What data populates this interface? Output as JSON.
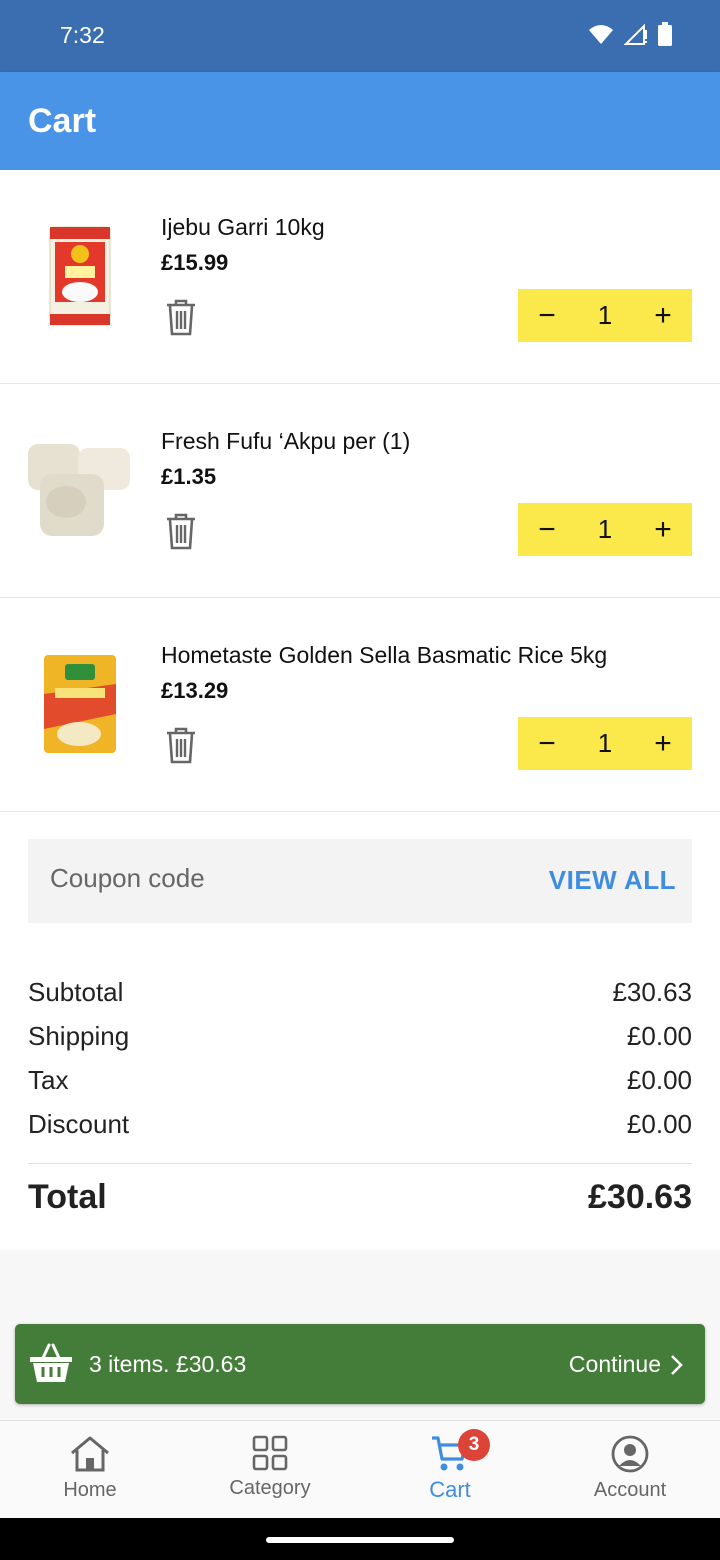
{
  "status_bar": {
    "time": "7:32"
  },
  "app_bar": {
    "title": "Cart"
  },
  "cart": {
    "items": [
      {
        "name": "Ijebu Garri 10kg",
        "price": "£15.99",
        "quantity": "1"
      },
      {
        "name": "Fresh Fufu ‘Akpu per (1)",
        "price": "£1.35",
        "quantity": "1"
      },
      {
        "name": "Hometaste Golden Sella Basmatic Rice 5kg",
        "price": "£13.29",
        "quantity": "1"
      }
    ],
    "minus_symbol": "−",
    "plus_symbol": "+"
  },
  "coupon": {
    "placeholder": "Coupon code",
    "view_all": "VIEW ALL"
  },
  "summary": {
    "subtotal_label": "Subtotal",
    "subtotal_value": "£30.63",
    "shipping_label": "Shipping",
    "shipping_value": "£0.00",
    "tax_label": "Tax",
    "tax_value": "£0.00",
    "discount_label": "Discount",
    "discount_value": "£0.00",
    "total_label": "Total",
    "total_value": "£30.63"
  },
  "checkout": {
    "summary": "3 items. £30.63",
    "continue_label": "Continue"
  },
  "bottom_nav": {
    "home": "Home",
    "category": "Category",
    "cart": "Cart",
    "cart_badge": "3",
    "account": "Account"
  },
  "colors": {
    "status_bar": "#3a6eb0",
    "app_bar": "#4a94e8",
    "quantity_bg": "#fbe84a",
    "accent": "#3f8ddf",
    "checkout_bar": "#447c3a",
    "badge": "#dd4438"
  },
  "icons": [
    "wifi-icon",
    "signal-icon",
    "battery-icon",
    "trash-icon",
    "basket-icon",
    "chevron-right-icon",
    "home-icon",
    "category-icon",
    "cart-icon",
    "account-icon"
  ]
}
